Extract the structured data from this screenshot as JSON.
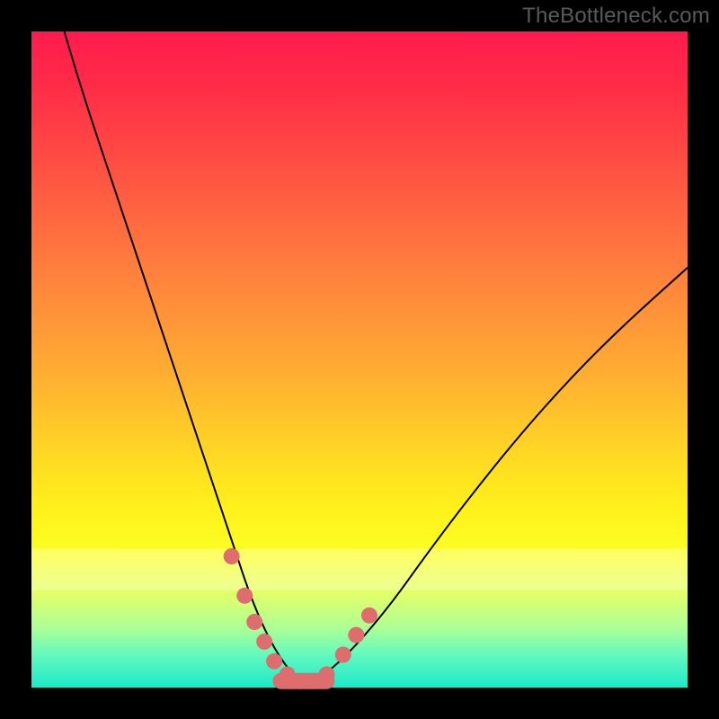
{
  "watermark": "TheBottleneck.com",
  "chart_data": {
    "type": "line",
    "title": "",
    "xlabel": "",
    "ylabel": "",
    "xlim": [
      0,
      100
    ],
    "ylim": [
      0,
      100
    ],
    "background_gradient": {
      "direction": "top-to-bottom",
      "stops": [
        {
          "pct": 0,
          "color": "#ff1b4d"
        },
        {
          "pct": 17,
          "color": "#ff4544"
        },
        {
          "pct": 40,
          "color": "#ff8a3b"
        },
        {
          "pct": 63,
          "color": "#ffd326"
        },
        {
          "pct": 80,
          "color": "#fbff25"
        },
        {
          "pct": 91,
          "color": "#abff96"
        },
        {
          "pct": 100,
          "color": "#1be9c9"
        }
      ]
    },
    "series": [
      {
        "name": "bottleneck-curve",
        "x": [
          5,
          8,
          12,
          16,
          20,
          24,
          28,
          31,
          33,
          35,
          37,
          39,
          41,
          43,
          46,
          50,
          55,
          60,
          66,
          74,
          82,
          90,
          100
        ],
        "y": [
          100,
          90,
          78,
          66,
          54,
          42,
          30,
          21,
          15,
          10,
          6,
          3,
          1,
          1,
          3,
          7,
          13,
          20,
          28,
          38,
          47,
          55,
          64
        ]
      }
    ],
    "highlight_band": {
      "y_center": 18,
      "y_thickness": 6
    },
    "markers": [
      {
        "x": 30.5,
        "y": 20
      },
      {
        "x": 32.5,
        "y": 14
      },
      {
        "x": 34.0,
        "y": 10
      },
      {
        "x": 35.5,
        "y": 7
      },
      {
        "x": 37.0,
        "y": 4
      },
      {
        "x": 39.0,
        "y": 2
      },
      {
        "x": 41.0,
        "y": 1
      },
      {
        "x": 43.0,
        "y": 1
      },
      {
        "x": 45.0,
        "y": 2
      },
      {
        "x": 47.5,
        "y": 5
      },
      {
        "x": 49.5,
        "y": 8
      },
      {
        "x": 51.5,
        "y": 11
      }
    ],
    "plateau_segment": {
      "x_start": 38,
      "x_end": 45,
      "y": 1
    }
  }
}
